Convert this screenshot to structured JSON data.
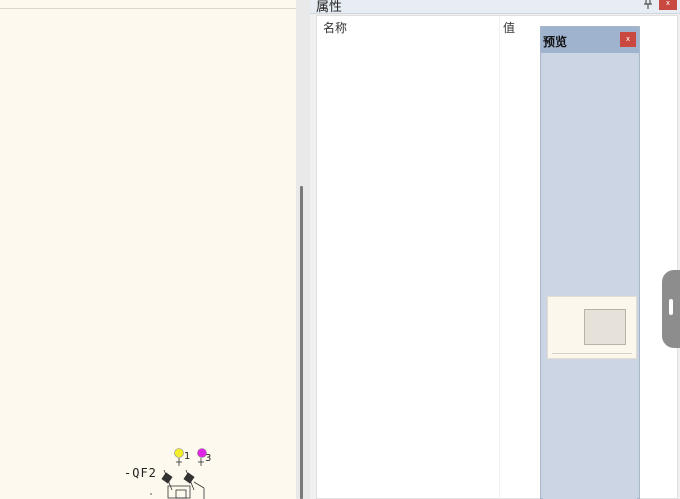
{
  "panel": {
    "title": "属性",
    "close_glyph": "x",
    "columns": {
      "name": "名称",
      "value": "值"
    }
  },
  "preview": {
    "title": "预览",
    "close_glyph": "x"
  },
  "drawing": {
    "device_label": "-QF2",
    "terminal_1": "1",
    "terminal_3": "3"
  },
  "icons": {
    "expand": "expand-arrow-icon",
    "pin": "pin-icon",
    "close": "close-icon"
  },
  "colors": {
    "canvas_bg": "#fdf9ee",
    "preview_bg": "#c9d4e3",
    "preview_header": "#9fb3cf",
    "close_red": "#c9483f",
    "terminal_yellow": "#f2ef2a",
    "terminal_magenta": "#e024e6"
  }
}
